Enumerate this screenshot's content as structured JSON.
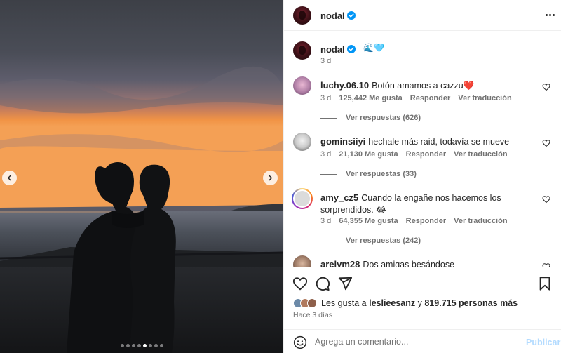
{
  "post": {
    "account": "nodal",
    "verified": true,
    "caption_emojis": "🌊🩵",
    "caption_time": "3 d",
    "carousel": {
      "dots_total": 8,
      "active_index": 4
    }
  },
  "comments": [
    {
      "user": "luchy.06.10",
      "text": "Botón amamos a cazzu❤️",
      "time": "3 d",
      "likes": "125,442 Me gusta",
      "reply": "Responder",
      "translate": "Ver traducción",
      "replies": "Ver respuestas (626)"
    },
    {
      "user": "gominsiiyi",
      "text": "hechale más raid, todavía se mueve",
      "time": "3 d",
      "likes": "21,130 Me gusta",
      "reply": "Responder",
      "translate": "Ver traducción",
      "replies": "Ver respuestas (33)"
    },
    {
      "user": "amy_cz5",
      "text": "Cuando la engañe nos hacemos los sorprendidos. 😂",
      "time": "3 d",
      "likes": "64,355 Me gusta",
      "reply": "Responder",
      "translate": "Ver traducción",
      "replies": "Ver respuestas (242)"
    },
    {
      "user": "arelym28",
      "text": "Dos amigas besándose"
    }
  ],
  "likes": {
    "prefix": "Les gusta a",
    "user": "leslieesanz",
    "conj": "y",
    "count": "819.715 personas más"
  },
  "time_ago": "Hace 3 días",
  "composer": {
    "placeholder": "Agrega un comentario...",
    "publish": "Publicar"
  },
  "colors": {
    "verified": "#0095f6",
    "publish_disabled": "#b3dbff",
    "secondary_text": "#737373"
  }
}
